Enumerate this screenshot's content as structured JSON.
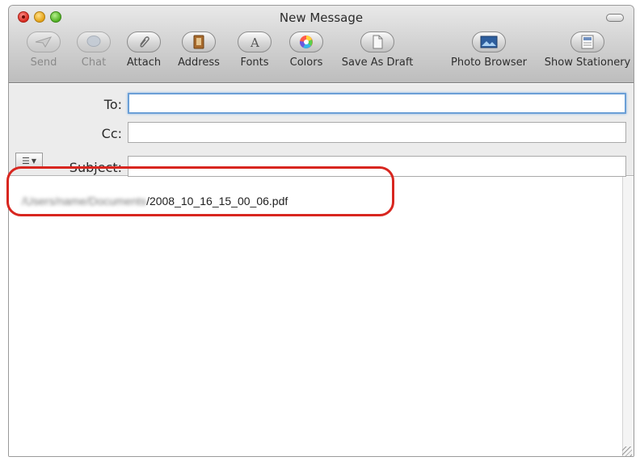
{
  "window": {
    "title": "New Message"
  },
  "toolbar": {
    "send": "Send",
    "chat": "Chat",
    "attach": "Attach",
    "address": "Address",
    "fonts": "Fonts",
    "colors": "Colors",
    "save_draft": "Save As Draft",
    "photo_browser": "Photo Browser",
    "show_stationery": "Show Stationery"
  },
  "headers": {
    "to_label": "To:",
    "to_value": "",
    "cc_label": "Cc:",
    "cc_value": "",
    "subject_label": "Subject:",
    "subject_value": ""
  },
  "message": {
    "attachment_path_hidden": "/Users/name/Documents",
    "attachment_filename": "/2008_10_16_15_00_06.pdf"
  },
  "icons": {
    "send": "paper-plane-icon",
    "chat": "chat-bubble-icon",
    "attach": "paperclip-icon",
    "address": "address-book-icon",
    "fonts": "font-icon",
    "colors": "color-wheel-icon",
    "save_draft": "document-icon",
    "photo_browser": "photo-icon",
    "show_stationery": "stationery-icon"
  },
  "colors": {
    "highlight": "#d8261f",
    "focus": "#6b9fd6"
  }
}
